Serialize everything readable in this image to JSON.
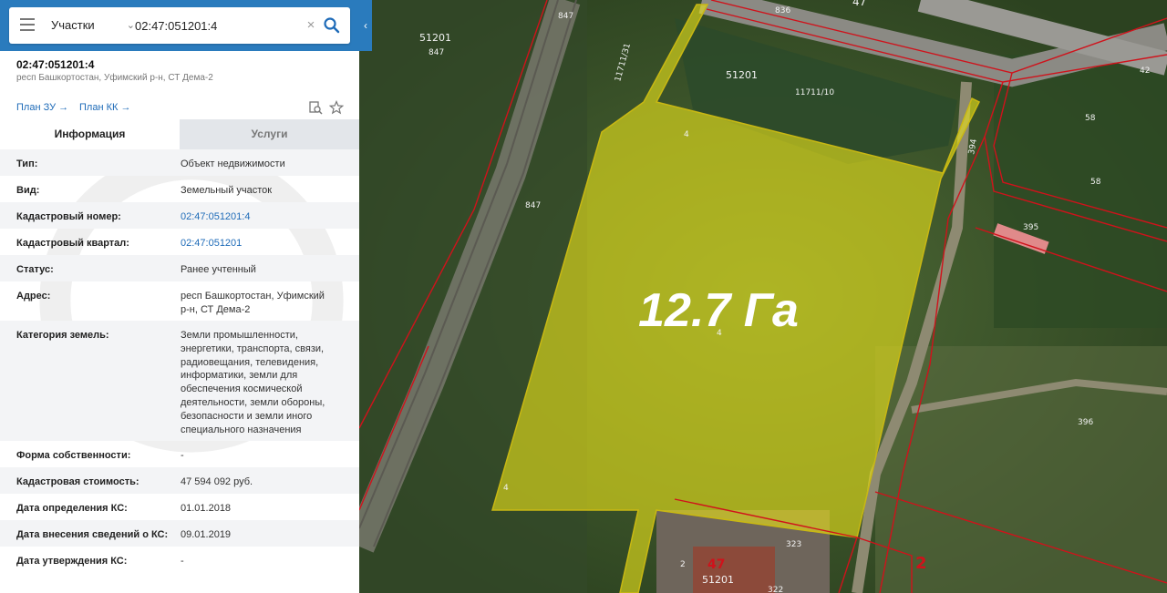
{
  "search": {
    "type_label": "Участки",
    "query": "02:47:051201:4",
    "clear_symbol": "×"
  },
  "parcel": {
    "cad_number": "02:47:051201:4",
    "address_short": "респ Башкортостан, Уфимский р-н, СТ Дема-2",
    "plan_zu": "План ЗУ",
    "plan_kk": "План КК"
  },
  "tabs": {
    "info": "Информация",
    "services": "Услуги"
  },
  "props": [
    {
      "key": "Тип:",
      "value": "Объект недвижимости"
    },
    {
      "key": "Вид:",
      "value": "Земельный участок"
    },
    {
      "key": "Кадастровый номер:",
      "value": "02:47:051201:4"
    },
    {
      "key": "Кадастровый квартал:",
      "value": "02:47:051201"
    },
    {
      "key": "Статус:",
      "value": "Ранее учтенный"
    },
    {
      "key": "Адрес:",
      "value": "респ Башкортостан, Уфимский р-н, СТ Дема-2"
    },
    {
      "key": "Категория земель:",
      "value": "Земли промышленности, энергетики, транспорта, связи, радиовещания, телевидения, информатики, земли для обеспечения космической деятельности, земли обороны, безопасности и земли иного специального назначения"
    },
    {
      "key": "Форма собственности:",
      "value": "-"
    },
    {
      "key": "Кадастровая стоимость:",
      "value": "47 594 092 руб."
    },
    {
      "key": "Дата определения КС:",
      "value": "01.01.2018"
    },
    {
      "key": "Дата внесения сведений о КС:",
      "value": "09.01.2019"
    },
    {
      "key": "Дата утверждения КС:",
      "value": "-"
    }
  ],
  "map": {
    "area_label": "12.7 Га",
    "labels": {
      "l847a": "847",
      "l847b": "847",
      "l847c": "847",
      "l836": "836",
      "l47a": "47",
      "l51201a": "51201",
      "l51201b": "51201",
      "l11711_31": "11711/31",
      "l11711_10": "11711/10",
      "l42": "42",
      "l58a": "58",
      "l58b": "58",
      "l394": "394",
      "l395": "395",
      "l396": "396",
      "l4a": "4",
      "l4b": "4",
      "l4c": "4",
      "l323": "323",
      "l2a": "2",
      "l47b": "47",
      "l51201c": "51201",
      "l2b": "2",
      "l322": "322"
    },
    "colors": {
      "parcel_fill": "#e8e21a",
      "boundary": "#d0121b"
    }
  }
}
